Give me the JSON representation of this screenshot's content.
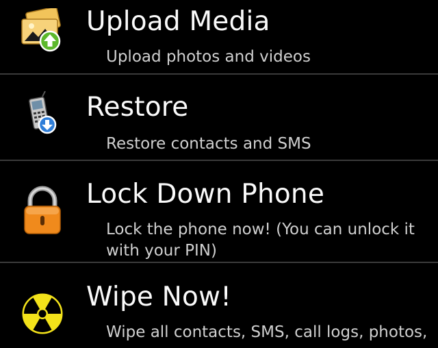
{
  "menu": {
    "items": [
      {
        "title": "Upload Media",
        "description": "Upload photos and videos",
        "icon": "upload-media-icon"
      },
      {
        "title": "Restore",
        "description": "Restore contacts and SMS",
        "icon": "restore-phone-icon"
      },
      {
        "title": "Lock Down Phone",
        "description": "Lock the phone now! (You can unlock it with your PIN)",
        "icon": "padlock-icon"
      },
      {
        "title": "Wipe Now!",
        "description": "Wipe all contacts, SMS, call logs, photos,",
        "icon": "radiation-icon"
      }
    ]
  },
  "colors": {
    "background": "#000000",
    "divider": "#3b3b3b",
    "lock_orange": "#f08a1c",
    "wipe_yellow": "#f3e21a",
    "upload_green": "#5cb82c",
    "restore_blue": "#2f7ed8"
  }
}
